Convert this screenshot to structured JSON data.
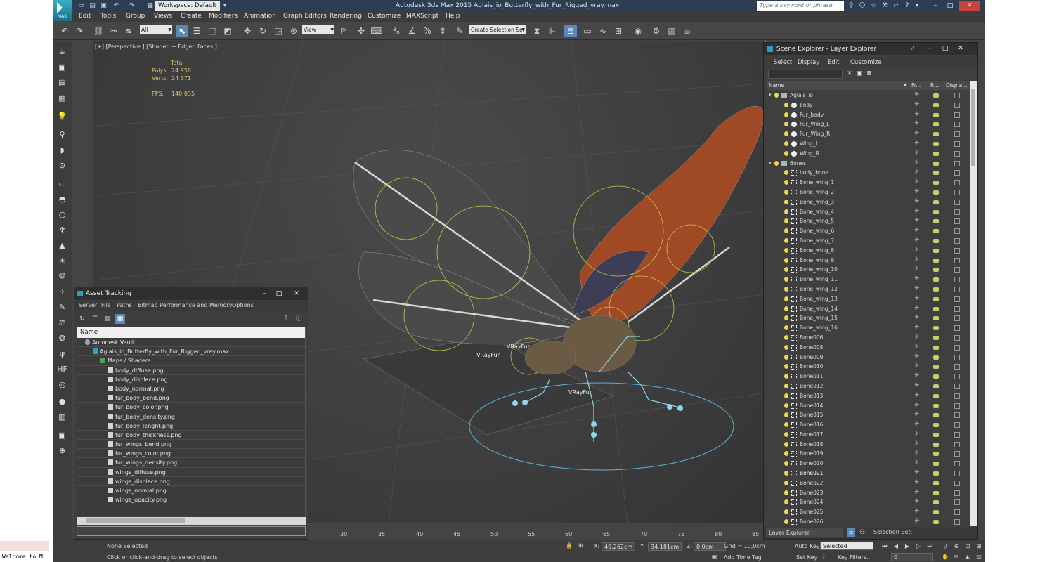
{
  "app": {
    "logo_text": "MAX",
    "window_title": "Autodesk 3ds Max  2015      Aglais_io_Butterfly_with_Fur_Rigged_vray.max",
    "workspace": "Workspace: Default",
    "help_search_placeholder": "Type a keyword or phrase"
  },
  "menu": [
    "Edit",
    "Tools",
    "Group",
    "Views",
    "Create",
    "Modifiers",
    "Animation",
    "Graph Editors",
    "Rendering",
    "Customize",
    "MAXScript",
    "Help"
  ],
  "toolbar": {
    "filter_dropdown": "All",
    "ref_coord_dropdown": "View",
    "selection_set_dropdown": "Create Selection Se"
  },
  "viewport": {
    "label": "[+] [Perspective ] [Shaded + Edged Faces ]",
    "stats": {
      "header": "Total",
      "polys_label": "Polys:",
      "polys_value": "24 958",
      "verts_label": "Verts:",
      "verts_value": "24 371",
      "fps_label": "FPS:",
      "fps_value": "140,035"
    },
    "labels": [
      "VRayFur",
      "VRayFur",
      "VRayFur"
    ]
  },
  "timeline": {
    "ticks": [
      "30",
      "35",
      "40",
      "45",
      "50",
      "55",
      "60",
      "65",
      "70",
      "75",
      "80",
      "85"
    ]
  },
  "asset_tracking": {
    "title": "Asset Tracking",
    "menu": [
      "Server",
      "File",
      "Paths",
      "Bitmap Performance and Memory",
      "Options"
    ],
    "header": "Name",
    "rows": [
      {
        "label": "Autodesk Vault",
        "indent": 1,
        "kind": "vault"
      },
      {
        "label": "Aglais_io_Butterfly_with_Fur_Rigged_vray.max",
        "indent": 2,
        "kind": "maxfile"
      },
      {
        "label": "Maps / Shaders",
        "indent": 3,
        "kind": "maps"
      },
      {
        "label": "body_diffuse.png",
        "indent": 4,
        "kind": "file"
      },
      {
        "label": "body_displace.png",
        "indent": 4,
        "kind": "file"
      },
      {
        "label": "body_normal.png",
        "indent": 4,
        "kind": "file"
      },
      {
        "label": "fur_body_bend.png",
        "indent": 4,
        "kind": "file"
      },
      {
        "label": "fur_body_color.png",
        "indent": 4,
        "kind": "file"
      },
      {
        "label": "fur_body_density.png",
        "indent": 4,
        "kind": "file"
      },
      {
        "label": "fur_body_lenght.png",
        "indent": 4,
        "kind": "file"
      },
      {
        "label": "fur_body_thickness.png",
        "indent": 4,
        "kind": "file"
      },
      {
        "label": "fur_wings_bend.png",
        "indent": 4,
        "kind": "file"
      },
      {
        "label": "fur_wings_color.png",
        "indent": 4,
        "kind": "file"
      },
      {
        "label": "fur_wings_density.png",
        "indent": 4,
        "kind": "file"
      },
      {
        "label": "wings_diffuse.png",
        "indent": 4,
        "kind": "file"
      },
      {
        "label": "wings_displace.png",
        "indent": 4,
        "kind": "file"
      },
      {
        "label": "wings_normal.png",
        "indent": 4,
        "kind": "file"
      },
      {
        "label": "wings_opacity.png",
        "indent": 4,
        "kind": "file"
      }
    ]
  },
  "scene_explorer": {
    "title": "Scene Explorer - Layer Explorer",
    "menu": [
      "Select",
      "Display",
      "Edit",
      "Customize"
    ],
    "columns": {
      "name": "Name",
      "frozen": "Fr...",
      "render": "R...",
      "display": "Displa..."
    },
    "rows": [
      {
        "label": "Aglais_io",
        "level": 0,
        "kind": "layer",
        "expand": "▾"
      },
      {
        "label": "body",
        "level": 1,
        "kind": "geo"
      },
      {
        "label": "Fur_body",
        "level": 1,
        "kind": "geo"
      },
      {
        "label": "Fur_Wing_L",
        "level": 1,
        "kind": "geo"
      },
      {
        "label": "Fur_Wing_R",
        "level": 1,
        "kind": "geo"
      },
      {
        "label": "Wing_L",
        "level": 1,
        "kind": "geo"
      },
      {
        "label": "Wing_R",
        "level": 1,
        "kind": "geo"
      },
      {
        "label": "Bones",
        "level": 0,
        "kind": "layer",
        "expand": "▾"
      },
      {
        "label": "body_bone",
        "level": 1,
        "kind": "bone"
      },
      {
        "label": "Bone_wing_1",
        "level": 1,
        "kind": "bone"
      },
      {
        "label": "Bone_wing_2",
        "level": 1,
        "kind": "bone"
      },
      {
        "label": "Bone_wing_3",
        "level": 1,
        "kind": "bone"
      },
      {
        "label": "Bone_wing_4",
        "level": 1,
        "kind": "bone"
      },
      {
        "label": "Bone_wing_5",
        "level": 1,
        "kind": "bone"
      },
      {
        "label": "Bone_wing_6",
        "level": 1,
        "kind": "bone"
      },
      {
        "label": "Bone_wing_7",
        "level": 1,
        "kind": "bone"
      },
      {
        "label": "Bone_wing_8",
        "level": 1,
        "kind": "bone"
      },
      {
        "label": "Bone_wing_9",
        "level": 1,
        "kind": "bone"
      },
      {
        "label": "Bone_wing_10",
        "level": 1,
        "kind": "bone"
      },
      {
        "label": "Bone_wing_11",
        "level": 1,
        "kind": "bone"
      },
      {
        "label": "Bone_wing_12",
        "level": 1,
        "kind": "bone"
      },
      {
        "label": "Bone_wing_13",
        "level": 1,
        "kind": "bone"
      },
      {
        "label": "Bone_wing_14",
        "level": 1,
        "kind": "bone"
      },
      {
        "label": "Bone_wing_15",
        "level": 1,
        "kind": "bone"
      },
      {
        "label": "Bone_wing_16",
        "level": 1,
        "kind": "bone"
      },
      {
        "label": "Bone006",
        "level": 1,
        "kind": "bone"
      },
      {
        "label": "Bone008",
        "level": 1,
        "kind": "bone"
      },
      {
        "label": "Bone009",
        "level": 1,
        "kind": "bone"
      },
      {
        "label": "Bone010",
        "level": 1,
        "kind": "bone"
      },
      {
        "label": "Bone011",
        "level": 1,
        "kind": "bone"
      },
      {
        "label": "Bone012",
        "level": 1,
        "kind": "bone"
      },
      {
        "label": "Bone013",
        "level": 1,
        "kind": "bone"
      },
      {
        "label": "Bone014",
        "level": 1,
        "kind": "bone"
      },
      {
        "label": "Bone015",
        "level": 1,
        "kind": "bone"
      },
      {
        "label": "Bone016",
        "level": 1,
        "kind": "bone"
      },
      {
        "label": "Bone017",
        "level": 1,
        "kind": "bone"
      },
      {
        "label": "Bone018",
        "level": 1,
        "kind": "bone"
      },
      {
        "label": "Bone019",
        "level": 1,
        "kind": "bone"
      },
      {
        "label": "Bone020",
        "level": 1,
        "kind": "bone"
      },
      {
        "label": "Bone021",
        "level": 1,
        "kind": "bone",
        "highlight": true
      },
      {
        "label": "Bone022",
        "level": 1,
        "kind": "bone"
      },
      {
        "label": "Bone023",
        "level": 1,
        "kind": "bone"
      },
      {
        "label": "Bone024",
        "level": 1,
        "kind": "bone"
      },
      {
        "label": "Bone025",
        "level": 1,
        "kind": "bone"
      },
      {
        "label": "Bone026",
        "level": 1,
        "kind": "bone"
      }
    ],
    "layer_dropdown": "Layer Explorer",
    "selection_set_label": "Selection Set:"
  },
  "status": {
    "maxscript_text": "Welcome to M",
    "selection": "None Selected",
    "prompt": "Click or click-and-drag to select objects",
    "x_label": "X:",
    "x_value": "49,262cm",
    "y_label": "Y:",
    "y_value": "34,181cm",
    "z_label": "Z:",
    "z_value": "0,0cm",
    "grid": "Grid = 10,0cm",
    "add_time_tag": "Add Time Tag",
    "auto_key": "Auto Key",
    "set_key": "Set Key",
    "key_mode": "Selected",
    "key_filters": "Key Filters...",
    "frame": "0"
  },
  "colors": {
    "accent": "#5b88b8",
    "viewport_border": "#d2a21c",
    "stats_text": "#ddc46a"
  }
}
